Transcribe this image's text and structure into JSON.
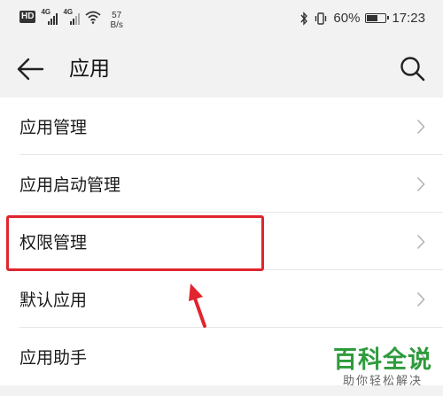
{
  "status_bar": {
    "hd_label": "HD",
    "signal1_tag": "4G",
    "signal2_tag": "4G",
    "net_speed_value": "57",
    "net_speed_unit": "B/s",
    "battery_percent": "60%",
    "battery_level": 0.6,
    "time": "17:23"
  },
  "app_bar": {
    "title": "应用",
    "icons": [
      "back-arrow-icon",
      "search-icon"
    ]
  },
  "list_items": [
    {
      "label": "应用管理"
    },
    {
      "label": "应用启动管理"
    },
    {
      "label": "权限管理"
    },
    {
      "label": "默认应用"
    },
    {
      "label": "应用助手"
    }
  ],
  "annotation": {
    "highlight_color": "#e0252e",
    "highlighted_item": "权限管理"
  },
  "watermark": {
    "title": "百科全说",
    "subtitle": "助你轻松解决"
  }
}
